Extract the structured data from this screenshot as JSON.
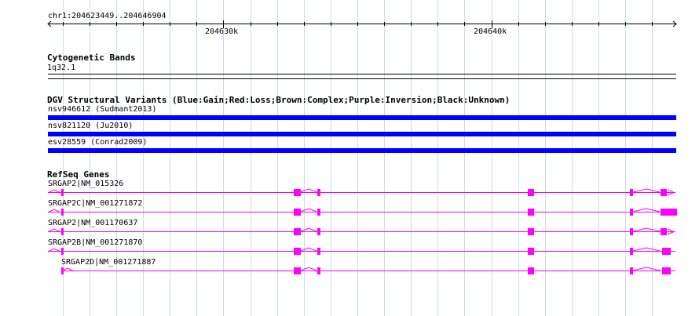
{
  "ruler": {
    "region_label": "chr1:204623449..204646904",
    "region_start": 204623449,
    "region_end": 204646904,
    "ticks": [
      {
        "label": "204630k",
        "position": 204630000
      },
      {
        "label": "204640k",
        "position": 204640000
      }
    ]
  },
  "tracks": {
    "cytoband": {
      "title": "Cytogenetic Bands",
      "band_label": "1q32.1"
    },
    "dgv": {
      "title": "DGV Structural Variants (Blue:Gain;Red:Loss;Brown:Complex;Purple:Inversion;Black:Unknown)",
      "color": "#0000ff",
      "features": [
        {
          "label": "nsv946612 (Sudmant2013)"
        },
        {
          "label": "nsv821120 (Ju2010)"
        },
        {
          "label": "esv28559 (Conrad2009)"
        }
      ]
    },
    "refseq": {
      "title": "RefSeq Genes",
      "color": "#ff00ff",
      "genes": [
        {
          "label": "SRGAP2|NM_015326",
          "strand": "+",
          "end_style": "arrow"
        },
        {
          "label": "SRGAP2C|NM_001271872",
          "strand": "+",
          "end_style": "wide"
        },
        {
          "label": "SRGAP2|NM_001170637",
          "strand": "+",
          "end_style": "arrow"
        },
        {
          "label": "SRGAP2B|NM_001271870",
          "strand": "+",
          "end_style": "block"
        },
        {
          "label": "SRGAP2D|NM_001271887",
          "strand": "+",
          "end_style": "block"
        }
      ]
    }
  },
  "colors": {
    "grid": "#c8dcf0",
    "gene": "#ff00ff",
    "variant": "#0000ff"
  }
}
